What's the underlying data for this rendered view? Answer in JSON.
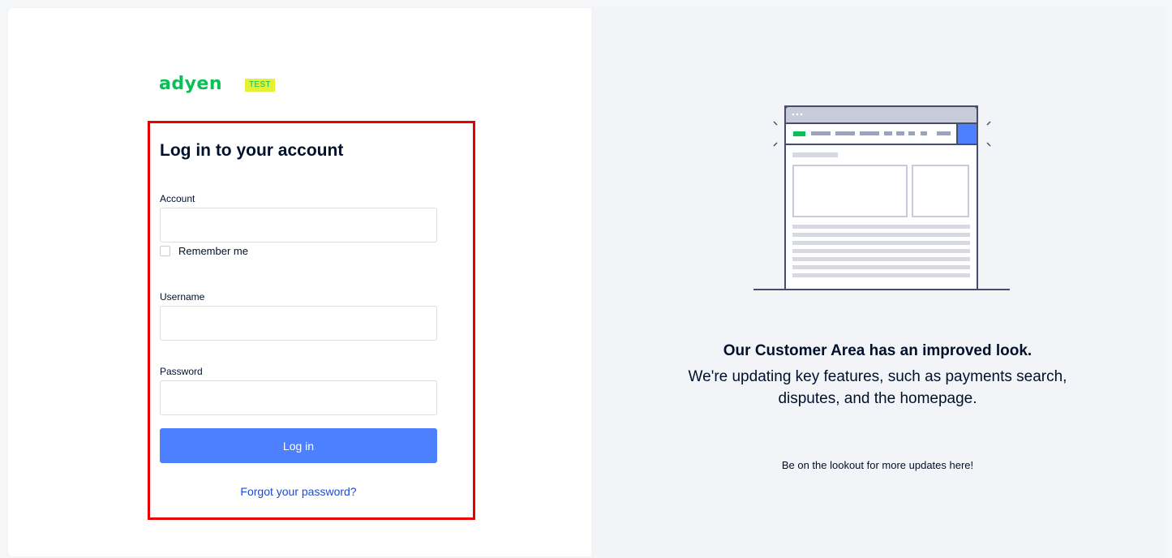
{
  "brand": {
    "logo_text": "adyen",
    "env_badge": "TEST",
    "logo_color": "#0abf53",
    "badge_bg": "#e5f233"
  },
  "login": {
    "title": "Log in to your account",
    "account_label": "Account",
    "account_value": "",
    "remember_label": "Remember me",
    "remember_checked": false,
    "username_label": "Username",
    "username_value": "",
    "password_label": "Password",
    "password_value": "",
    "submit_label": "Log in",
    "forgot_link": "Forgot your password?",
    "highlight_color": "#e60000",
    "button_color": "#4d80ff"
  },
  "promo": {
    "illustration": "browser-window-icon",
    "headline": "Our Customer Area has an improved look.",
    "body": "We're updating key features, such as payments search, disputes, and the homepage.",
    "footer": "Be on the lookout for more updates here!"
  }
}
